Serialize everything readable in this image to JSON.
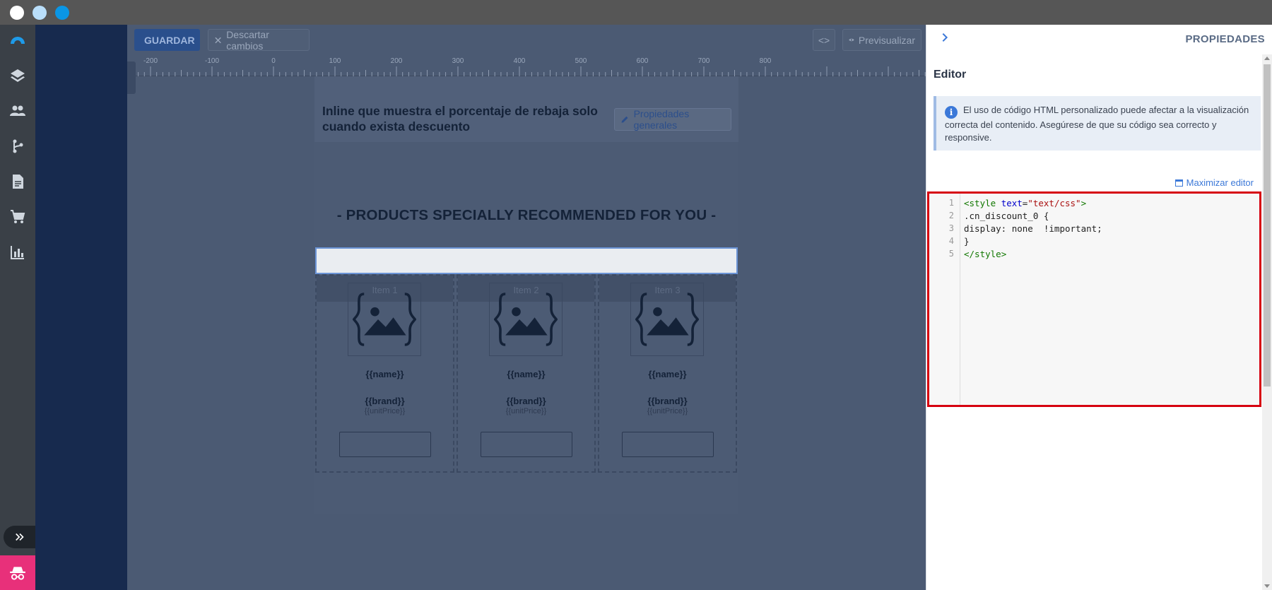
{
  "toolbar": {
    "save_label": "GUARDAR",
    "discard_label": "Descartar cambios",
    "code_label": "<>",
    "preview_label": "Previsualizar"
  },
  "ruler": {
    "labels": [
      "-200",
      "-100",
      "0",
      "100",
      "200",
      "300",
      "400",
      "500",
      "600",
      "700",
      "800"
    ]
  },
  "document": {
    "title": "Inline que muestra el porcentaje de rebaja solo cuando exista descuento",
    "general_props_label": "Propiedades generales",
    "products_title": "- PRODUCTS SPECIALLY RECOMMENDED FOR YOU -",
    "items": [
      {
        "label": "Item 1",
        "name": "{{name}}",
        "brand": "{{brand}}",
        "price": "{{unitPrice}}"
      },
      {
        "label": "Item 2",
        "name": "{{name}}",
        "brand": "{{brand}}",
        "price": "{{unitPrice}}"
      },
      {
        "label": "Item 3",
        "name": "{{name}}",
        "brand": "{{brand}}",
        "price": "{{unitPrice}}"
      }
    ]
  },
  "panel": {
    "title": "PROPIEDADES",
    "editor_heading": "Editor",
    "info_text": "El uso de código HTML personalizado puede afectar a la visualización correcta del contenido. Asegúrese de que su código sea correcto y responsive.",
    "maximize_label": "Maximizar editor",
    "code_lines": [
      "<style text=\"text/css\">",
      ".cn_discount_0 {",
      "display: none  !important;",
      "}",
      "</style>"
    ]
  },
  "colors": {
    "accent": "#3b78d8",
    "highlight_border": "#d6000f",
    "spy_button": "#e8307a"
  }
}
